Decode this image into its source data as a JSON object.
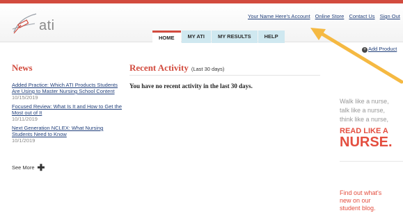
{
  "brand": {
    "logo_text": "ati"
  },
  "top_links": [
    {
      "label": "Your Name Here's Account"
    },
    {
      "label": "Online Store"
    },
    {
      "label": "Contact Us"
    },
    {
      "label": "Sign Out"
    }
  ],
  "tabs": [
    {
      "label": "HOME",
      "active": true
    },
    {
      "label": "MY ATI",
      "active": false
    },
    {
      "label": "MY RESULTS",
      "active": false
    },
    {
      "label": "HELP",
      "active": false
    }
  ],
  "add_product": {
    "label": "Add Product"
  },
  "news": {
    "title": "News",
    "items": [
      {
        "title": "Added Practice: Which ATI Products Students Are Using to Master Nursing School Content",
        "date": "10/15/2019"
      },
      {
        "title": "Focused Review: What Is It and How to Get the Most out of It",
        "date": "10/11/2019"
      },
      {
        "title": "Next Generation NCLEX: What Nursing Students Need to Know",
        "date": "10/1/2019"
      }
    ],
    "see_more": "See More"
  },
  "recent_activity": {
    "title": "Recent Activity",
    "subtitle": "(Last 30 days)",
    "empty_message": "You have no recent activity in the last 30 days."
  },
  "promo": {
    "lines": [
      "Walk like a nurse,",
      "talk like a nurse,",
      "think like a nurse,"
    ],
    "read_like": "READ LIKE A",
    "nurse": "NURSE."
  },
  "blog": {
    "lines": [
      "Find out what's",
      "new on our",
      "student blog."
    ]
  },
  "colors": {
    "accent_red": "#d24b3e",
    "link_blue": "#1f3e7a",
    "tab_blue": "#cfe8f0",
    "arrow_yellow": "#f5b942"
  },
  "annotation": {
    "icon": "arrow-pointer-icon"
  }
}
